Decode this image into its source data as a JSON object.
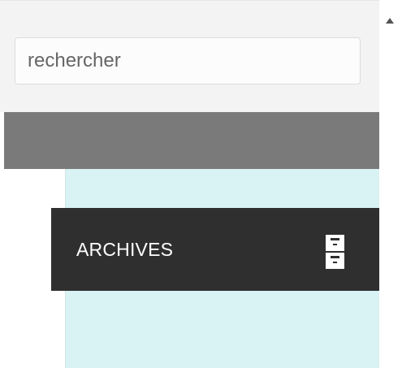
{
  "search": {
    "placeholder": "rechercher",
    "value": ""
  },
  "menu": {
    "archives_label": "ARCHIVES",
    "archives_icon": "archive-cabinet-icon"
  },
  "scrollbar": {
    "up_icon": "scroll-up-arrow-icon"
  },
  "colors": {
    "panel_bg": "#f3f3f3",
    "bar_bg": "#7a7a7a",
    "content_bg": "#d9f2f3",
    "button_bg": "#2f2f2f",
    "button_text": "#ffffff"
  }
}
